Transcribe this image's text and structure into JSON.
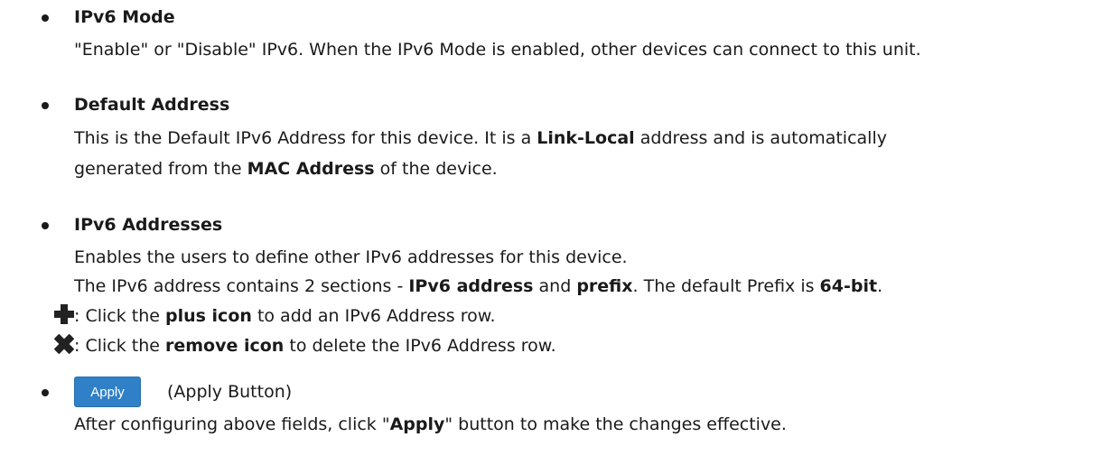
{
  "sections": {
    "ipv6_mode": {
      "title": "IPv6 Mode",
      "text": "\"Enable\" or \"Disable\" IPv6. When the IPv6 Mode is enabled, other devices can connect to this unit."
    },
    "default_address": {
      "title": "Default Address",
      "line1_a": "This is the Default IPv6 Address for this device. It is a ",
      "line1_bold": "Link-Local",
      "line1_b": " address and is automatically",
      "line2_a": "generated from the ",
      "line2_bold": "MAC Address",
      "line2_b": " of the device."
    },
    "ipv6_addresses": {
      "title": "IPv6 Addresses",
      "line1": "Enables the users to define other IPv6 addresses for this device.",
      "line2_a": "The IPv6 address contains 2 sections - ",
      "line2_bold1": "IPv6 address",
      "line2_mid": " and ",
      "line2_bold2": "prefix",
      "line2_c": ". The default Prefix is ",
      "line2_bold3": "64-bit",
      "line2_end": ".",
      "plus_a": ": Click the ",
      "plus_bold": "plus icon",
      "plus_b": " to add an IPv6 Address row.",
      "remove_a": ": Click the ",
      "remove_bold": "remove icon",
      "remove_b": " to delete the IPv6 Address row."
    },
    "apply": {
      "button_label": "Apply",
      "button_caption": "(Apply Button)",
      "text_a": "After configuring above fields, click \"",
      "text_bold": "Apply",
      "text_b": "\" button to make the changes effective."
    }
  },
  "icons": {
    "plus": "plus-icon",
    "remove": "remove-icon"
  },
  "colors": {
    "apply_button": "#2f80c7",
    "text": "#1a1a1a"
  }
}
